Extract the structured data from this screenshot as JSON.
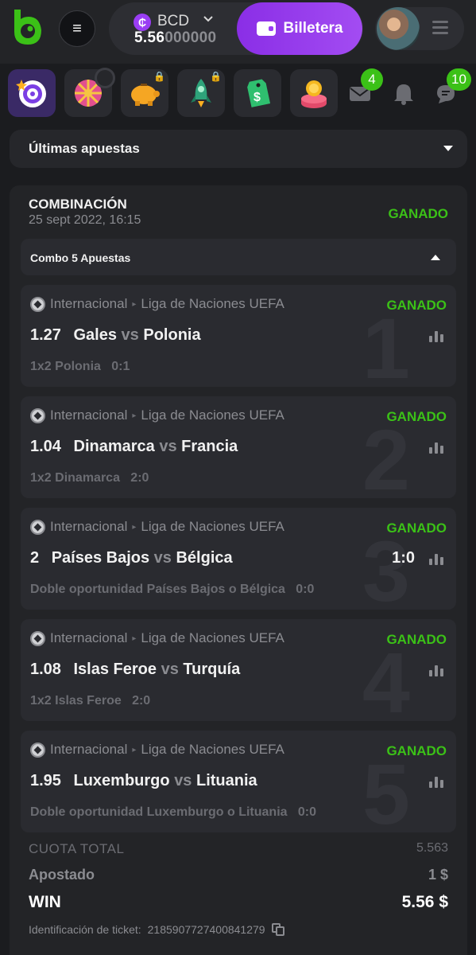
{
  "header": {
    "currency": "BCD",
    "amount_main": "5.56",
    "amount_dim": "000000",
    "wallet_label": "Billetera",
    "coin_symbol": "₵"
  },
  "iconbar": {
    "tiles": [
      "spin-target-icon",
      "lucky-wheel-icon",
      "piggy-bank-icon",
      "rocket-icon",
      "coupon-tag-icon",
      "coin-vault-icon"
    ],
    "mail_badge": "4",
    "chat_badge": "10"
  },
  "dropdown": {
    "label": "Últimas apuestas"
  },
  "card": {
    "title": "COMBINACIÓN",
    "date": "25 sept 2022, 16:15",
    "status": "GANADO",
    "combo_label": "Combo 5 Apuestas"
  },
  "bets": [
    {
      "number": "1",
      "sport": "Internacional",
      "league": "Liga de Naciones UEFA",
      "status": "GANADO",
      "odd": "1.27",
      "home": "Gales",
      "vs": "vs",
      "away": "Polonia",
      "score": "",
      "pick": "1x2 Polonia   0:1"
    },
    {
      "number": "2",
      "sport": "Internacional",
      "league": "Liga de Naciones UEFA",
      "status": "GANADO",
      "odd": "1.04",
      "home": "Dinamarca",
      "vs": "vs",
      "away": "Francia",
      "score": "",
      "pick": "1x2 Dinamarca   2:0"
    },
    {
      "number": "3",
      "sport": "Internacional",
      "league": "Liga de Naciones UEFA",
      "status": "GANADO",
      "odd": "2",
      "home": "Países Bajos",
      "vs": "vs",
      "away": "Bélgica",
      "score": "1:0",
      "pick": "Doble oportunidad Países Bajos o Bélgica   0:0"
    },
    {
      "number": "4",
      "sport": "Internacional",
      "league": "Liga de Naciones UEFA",
      "status": "GANADO",
      "odd": "1.08",
      "home": "Islas Feroe",
      "vs": "vs",
      "away": "Turquía",
      "score": "",
      "pick": "1x2 Islas Feroe   2:0"
    },
    {
      "number": "5",
      "sport": "Internacional",
      "league": "Liga de Naciones UEFA",
      "status": "GANADO",
      "odd": "1.95",
      "home": "Luxemburgo",
      "vs": "vs",
      "away": "Lituania",
      "score": "",
      "pick": "Doble oportunidad Luxemburgo o Lituania   0:0"
    }
  ],
  "summary": {
    "total_label": "CUOTA TOTAL",
    "total_value": "5.563",
    "stake_label": "Apostado",
    "stake_value": "1 $",
    "win_label": "WIN",
    "win_value": "5.56 $",
    "ticket_label": "Identificación de ticket:",
    "ticket_id": "2185907727400841279"
  },
  "colors": {
    "accent_purple": "#9a3df4",
    "won_green": "#3bc117",
    "background": "#1b1c1f",
    "card": "#232427"
  }
}
